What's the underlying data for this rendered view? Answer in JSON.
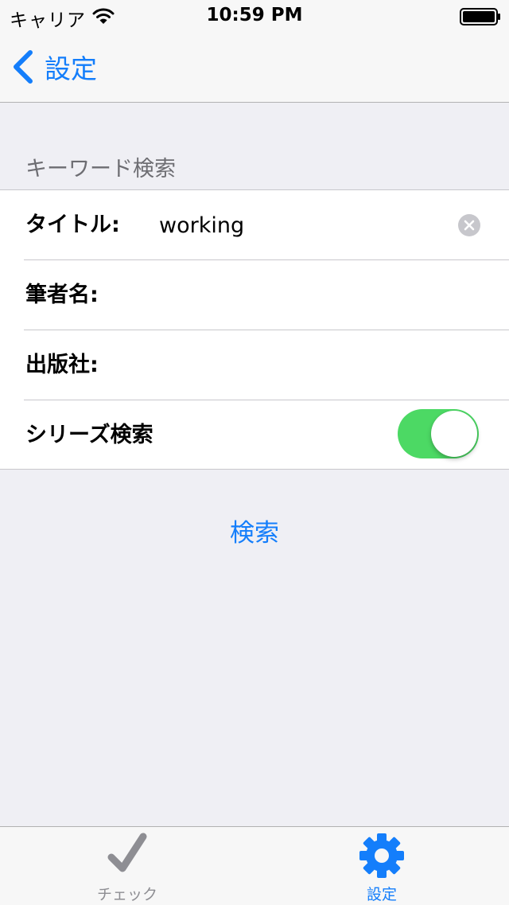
{
  "status_bar": {
    "carrier": "キャリア",
    "time": "10:59 PM",
    "icons": [
      "wifi-icon",
      "battery-icon"
    ]
  },
  "nav": {
    "back_label": "設定",
    "back_icon": "chevron-left-icon"
  },
  "section": {
    "header": "キーワード検索"
  },
  "rows": [
    {
      "label": "タイトル:",
      "value": "working"
    },
    {
      "label": "筆者名:",
      "value": ""
    },
    {
      "label": "出版社:",
      "value": ""
    },
    {
      "label": "シリーズ検索",
      "toggle_on": true
    }
  ],
  "search_button": {
    "label": "検索"
  },
  "tab_bar": {
    "tabs": [
      {
        "label": "チェック",
        "icon": "checkmark-icon",
        "selected": false
      },
      {
        "label": "設定",
        "icon": "gear-icon",
        "selected": true
      }
    ]
  },
  "colors": {
    "tint": "#147efb",
    "switch_on": "#4cd964",
    "background": "#efeff4",
    "bar_background": "#f7f7f7",
    "section_header_text": "#6d6d72",
    "inactive_tab": "#8e8e93"
  }
}
